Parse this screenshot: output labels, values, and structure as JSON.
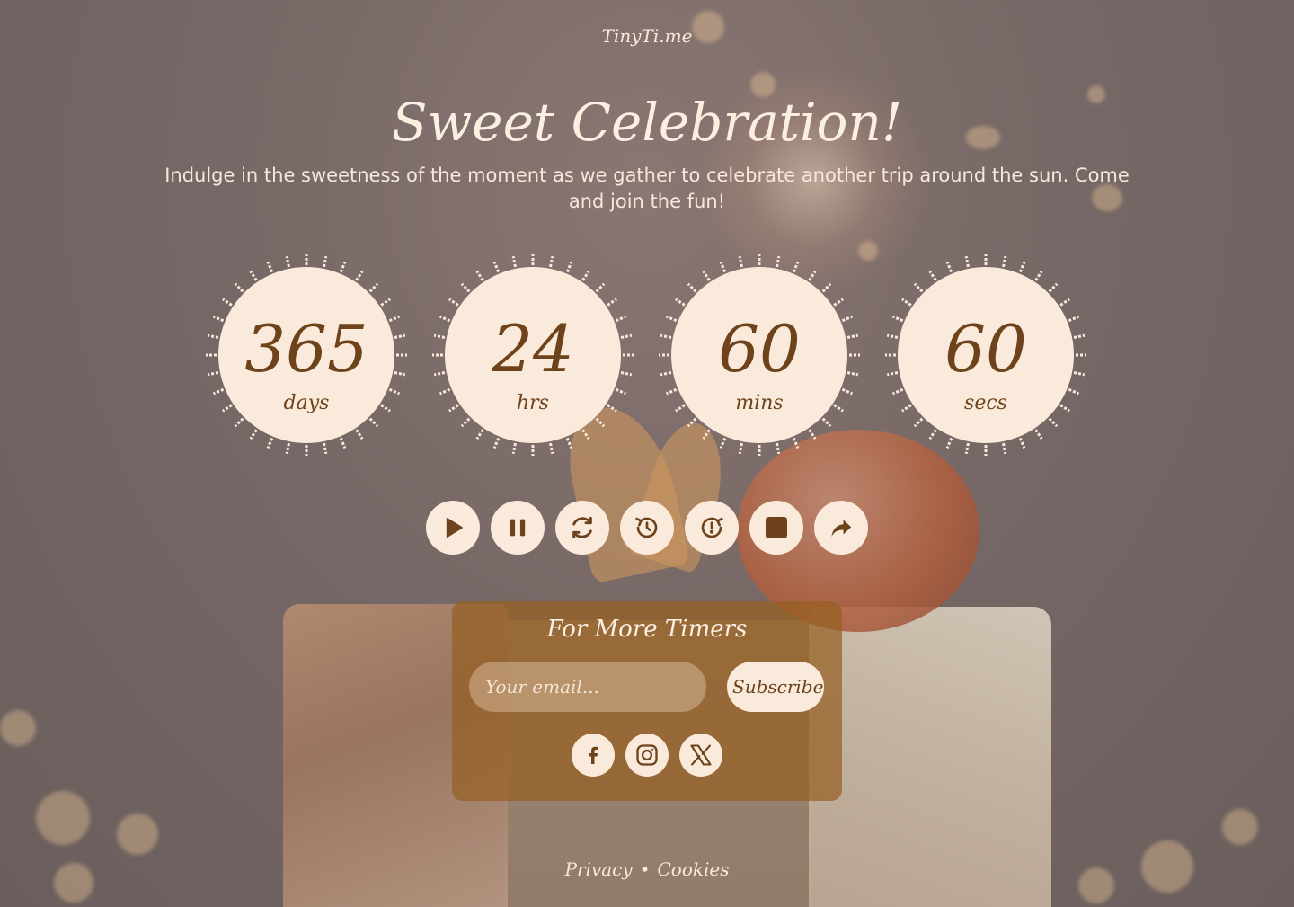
{
  "brand": "TinyTi.me",
  "hero": {
    "title": "Sweet Celebration!",
    "subtitle": "Indulge in the sweetness of the moment as we gather to celebrate another trip around the sun. Come and join the fun!"
  },
  "counters": [
    {
      "value": "365",
      "unit": "days"
    },
    {
      "value": "24",
      "unit": "hrs"
    },
    {
      "value": "60",
      "unit": "mins"
    },
    {
      "value": "60",
      "unit": "secs"
    }
  ],
  "controls": [
    {
      "icon": "play-icon"
    },
    {
      "icon": "pause-icon"
    },
    {
      "icon": "refresh-icon"
    },
    {
      "icon": "history-back-icon"
    },
    {
      "icon": "history-forward-icon"
    },
    {
      "icon": "stop-icon"
    },
    {
      "icon": "share-icon"
    }
  ],
  "subscribe": {
    "title": "For More Timers",
    "placeholder": "Your email...",
    "button_label": "Subscribe"
  },
  "social": [
    {
      "icon": "facebook-icon"
    },
    {
      "icon": "instagram-icon"
    },
    {
      "icon": "x-icon"
    }
  ],
  "footer": {
    "privacy": "Privacy",
    "separator": "•",
    "cookies": "Cookies"
  },
  "colors": {
    "accent_dark": "#6e431c",
    "cream": "#faeadb",
    "panel": "#965f23"
  }
}
